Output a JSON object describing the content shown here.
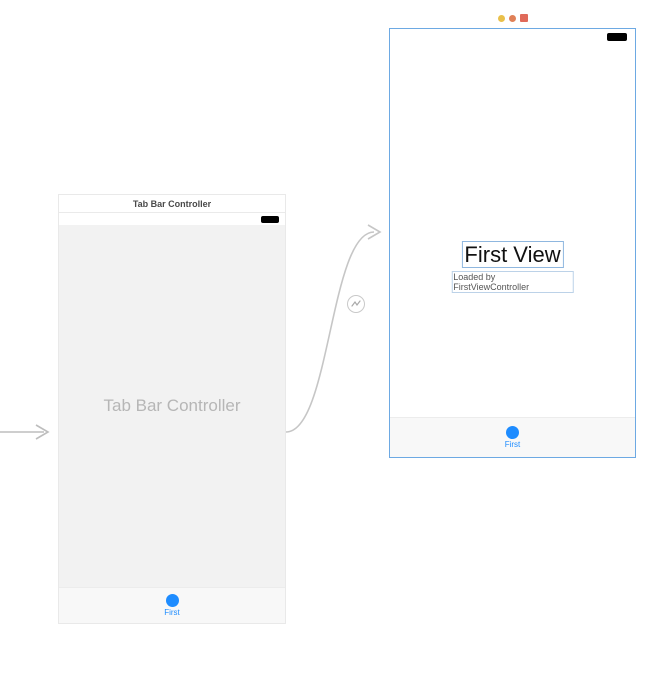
{
  "left_scene": {
    "title": "Tab Bar Controller",
    "body_label": "Tab Bar Controller",
    "tab": {
      "label": "First"
    }
  },
  "right_scene": {
    "title_text": "First View",
    "subtitle_text": "Loaded by FirstViewController",
    "tab": {
      "label": "First"
    }
  }
}
